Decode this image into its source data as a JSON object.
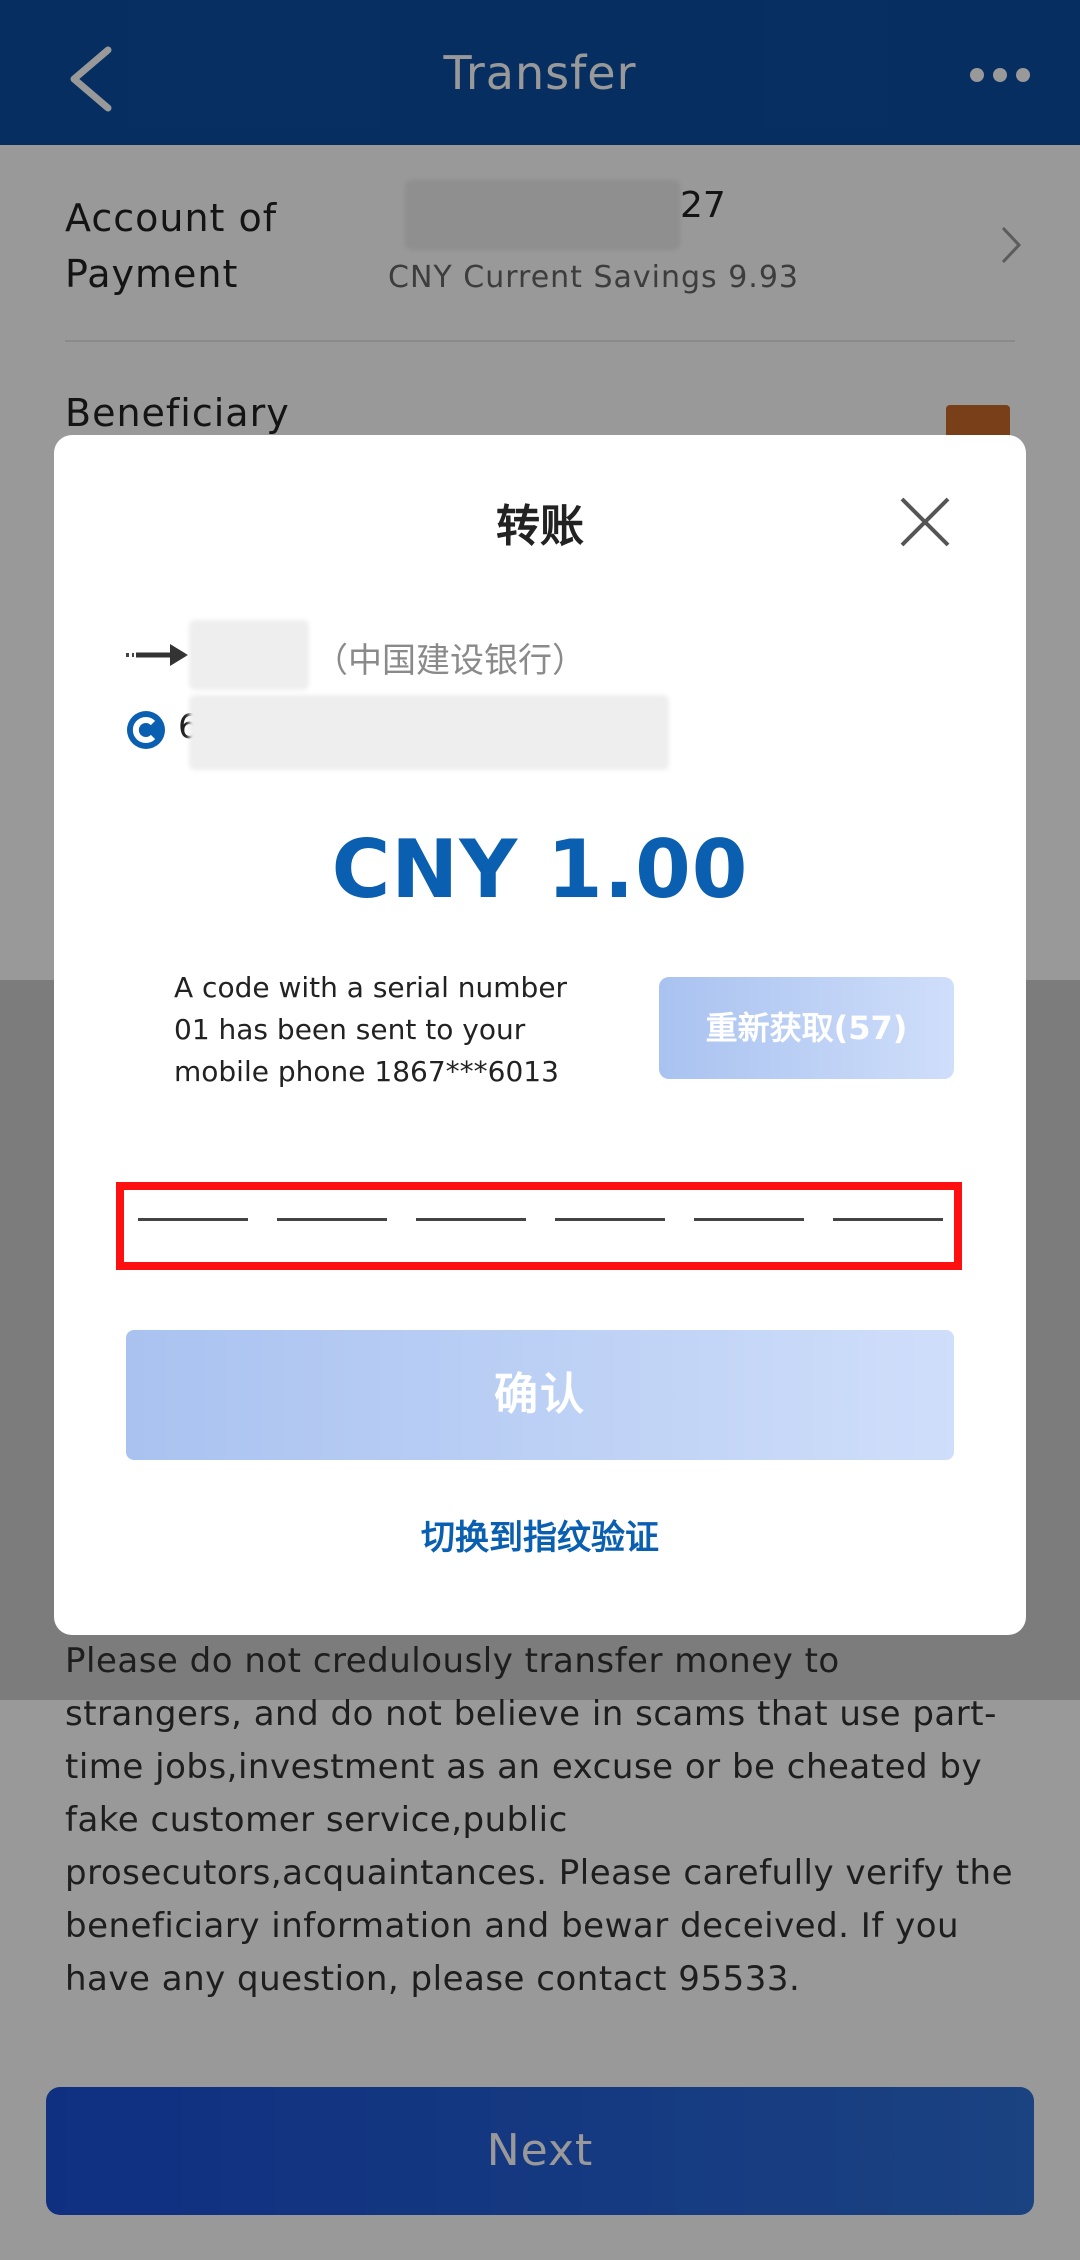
{
  "header": {
    "title": "Transfer"
  },
  "page": {
    "payment_label_line1": "Account of",
    "payment_label_line2": "Payment",
    "payment_value_suffix": "27",
    "payment_sub": "CNY Current Savings 9.93",
    "beneficiary_label": "Beneficiary",
    "warning_text": "Please do not credulously transfer money to strangers, and do not believe in scams that use part-time jobs,investment as an excuse or be cheated by fake customer service,public prosecutors,acquaintances. Please carefully verify the beneficiary information and bewar deceived. If you have any question, please contact 95533.",
    "next_label": "Next"
  },
  "modal": {
    "title": "转账",
    "bank_name": "（中国建设银行）",
    "account_prefix": "6",
    "amount": "CNY  1.00",
    "sms_message": "A code with a serial number 01 has been sent to your mobile phone 1867***6013",
    "resend_label": "重新获取(57)",
    "confirm_label": "确认",
    "fingerprint_label": "切换到指纹验证"
  }
}
